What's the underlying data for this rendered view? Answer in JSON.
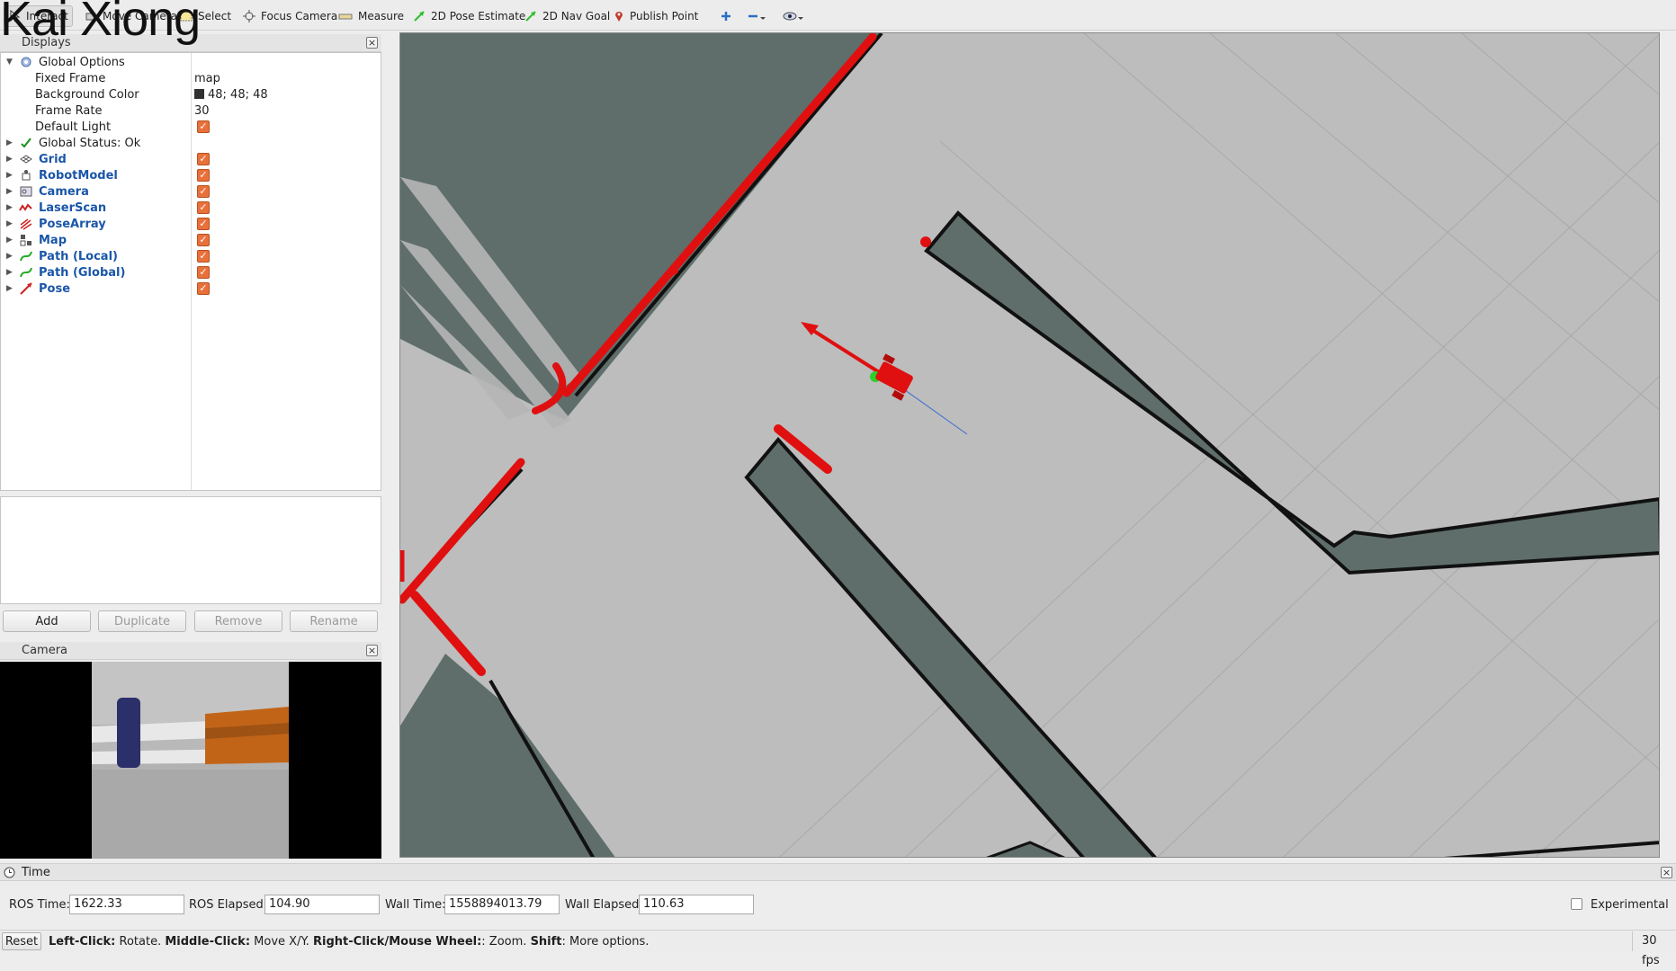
{
  "toolbar": {
    "tools": [
      {
        "label": "Interact",
        "icon": "interact-icon"
      },
      {
        "label": "Move Camera",
        "icon": "move-camera-icon"
      },
      {
        "label": "Select",
        "icon": "select-icon"
      },
      {
        "label": "Focus Camera",
        "icon": "focus-camera-icon"
      },
      {
        "label": "Measure",
        "icon": "measure-icon"
      },
      {
        "label": "2D Pose Estimate",
        "icon": "pose-estimate-icon"
      },
      {
        "label": "2D Nav Goal",
        "icon": "nav-goal-icon"
      },
      {
        "label": "Publish Point",
        "icon": "publish-point-icon"
      }
    ]
  },
  "overlay_text": "Kai Xiong",
  "displays": {
    "title": "Displays",
    "global_options": {
      "label": "Global Options",
      "fixed_frame_label": "Fixed Frame",
      "fixed_frame_value": "map",
      "background_color_label": "Background Color",
      "background_color_value": "48; 48; 48",
      "frame_rate_label": "Frame Rate",
      "frame_rate_value": "30",
      "default_light_label": "Default Light"
    },
    "global_status": "Global Status: Ok",
    "items": [
      {
        "label": "Grid",
        "icon": "grid-icon",
        "color": "#555555"
      },
      {
        "label": "RobotModel",
        "icon": "robot-model-icon",
        "color": "#555555"
      },
      {
        "label": "Camera",
        "icon": "camera-icon",
        "color": "#555555"
      },
      {
        "label": "LaserScan",
        "icon": "laser-scan-icon",
        "color": "#cc2222"
      },
      {
        "label": "PoseArray",
        "icon": "pose-array-icon",
        "color": "#cc2222"
      },
      {
        "label": "Map",
        "icon": "map-icon",
        "color": "#555555"
      },
      {
        "label": "Path (Local)",
        "icon": "path-icon",
        "color": "#22aa22"
      },
      {
        "label": "Path (Global)",
        "icon": "path-icon",
        "color": "#22aa22"
      },
      {
        "label": "Pose",
        "icon": "pose-icon",
        "color": "#cc2222"
      }
    ],
    "buttons": {
      "add": "Add",
      "duplicate": "Duplicate",
      "remove": "Remove",
      "rename": "Rename"
    }
  },
  "camera_panel": {
    "title": "Camera"
  },
  "time_panel": {
    "title": "Time",
    "ros_time_label": "ROS Time:",
    "ros_time": "1622.33",
    "ros_elapsed_label": "ROS Elapsed:",
    "ros_elapsed": "104.90",
    "wall_time_label": "Wall Time:",
    "wall_time": "1558894013.79",
    "wall_elapsed_label": "Wall Elapsed:",
    "wall_elapsed": "110.63",
    "experimental_label": "Experimental"
  },
  "status_bar": {
    "reset_label": "Reset",
    "hint_1_key": "Left-Click:",
    "hint_1": " Rotate. ",
    "hint_2_key": "Middle-Click:",
    "hint_2": " Move X/Y. ",
    "hint_3_key": "Right-Click/Mouse Wheel:",
    "hint_3": ": Zoom. ",
    "hint_4_key": "Shift",
    "hint_4": ": More options.",
    "fps": "30 fps"
  },
  "colors": {
    "obstacle": "#5f6e6b",
    "free_space": "#bdbdbd",
    "laser": "#e01010",
    "robot": "#e01010",
    "grid": "#a8a8a8",
    "accent_check": "#e9703a"
  }
}
